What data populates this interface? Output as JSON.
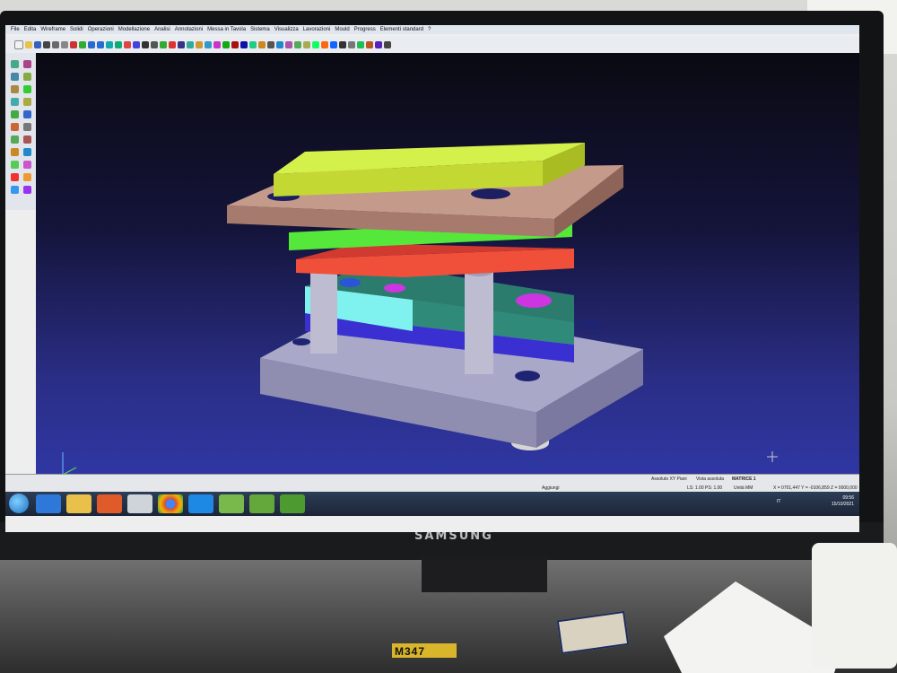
{
  "app": {
    "menu": [
      "File",
      "Edita",
      "Wireframe",
      "Solidi",
      "Operazioni",
      "Modellazione",
      "Analisi",
      "Annotazioni",
      "Messa in Tavola",
      "Sistema",
      "Visualizza",
      "Lavorazioni",
      "Mould",
      "Progress",
      "Elementi standard",
      "?"
    ]
  },
  "status": {
    "add_label": "Aggiungi",
    "coord_mode": "Assoluto XY Piani",
    "view_mode": "Vista assoluta",
    "part_name": "MATRICE 1",
    "layer_info": "LS: 1.00 PS: 1.00",
    "units": "Unità MM",
    "coords": "X = 0701,447 Y = -0106,859 Z = 0000,000"
  },
  "taskbar": {
    "lang": "IT",
    "time": "09:56",
    "date": "15/10/2021"
  },
  "monitor": {
    "brand": "SAMSUNG"
  },
  "desk": {
    "tape_label": "M347"
  },
  "colors": {
    "viewport_top": "#0a0a12",
    "viewport_bottom": "#3038a8",
    "plate_top": "#d4f04a",
    "plate_brown": "#c49a8a",
    "plate_green": "#55e83a",
    "plate_red": "#f0503a",
    "die_cyan": "#7ff2f0",
    "die_teal": "#2f8a7a",
    "base": "#aaa8c8"
  }
}
